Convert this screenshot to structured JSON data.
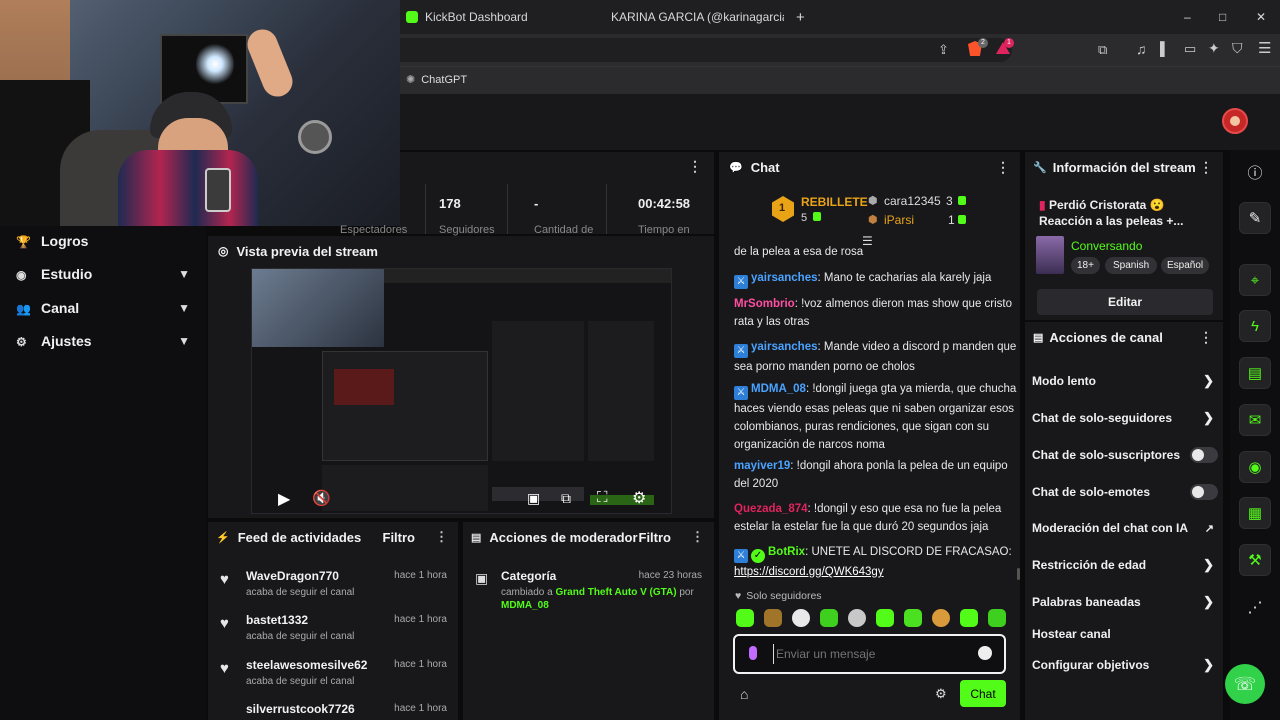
{
  "browser": {
    "tabs": [
      {
        "title": "KickBot Dashboard",
        "color": "#53fc18"
      },
      {
        "title": "KARINA GARCIA (@karinagarciaofici",
        "color": "#d62976"
      }
    ],
    "new_tab": "+",
    "window": {
      "minimize": "–",
      "maximize": "□",
      "close": "✕"
    },
    "bookmark": "ChatGPT",
    "toolbar_badges": {
      "brave": "2",
      "alert": "1"
    }
  },
  "stats": [
    {
      "value": "178",
      "label": "Seguidores"
    },
    {
      "value": "-",
      "label": "Cantidad de"
    },
    {
      "value": "00:42:58",
      "label": "Tiempo en"
    }
  ],
  "stats_first_label": "Espectadores",
  "leftnav": {
    "items": [
      {
        "label": "Logros",
        "icon": "trophy-icon",
        "glyph": "🏆",
        "chevron": false
      },
      {
        "label": "Estudio",
        "icon": "camera-icon",
        "glyph": "◉",
        "chevron": true
      },
      {
        "label": "Canal",
        "icon": "users-icon",
        "glyph": "👥",
        "chevron": true
      },
      {
        "label": "Ajustes",
        "icon": "gear-icon",
        "glyph": "⚙",
        "chevron": true
      }
    ]
  },
  "preview": {
    "title": "Vista previa del stream"
  },
  "feed": {
    "title": "Feed de actividades",
    "filter": "Filtro",
    "items": [
      {
        "name": "WaveDragon770",
        "time": "hace 1 hora",
        "desc": "acaba de seguir el canal"
      },
      {
        "name": "bastet1332",
        "time": "hace 1 hora",
        "desc": "acaba de seguir el canal"
      },
      {
        "name": "steelawesomesilve62",
        "time": "hace 1 hora",
        "desc": "acaba de seguir el canal"
      },
      {
        "name": "silverrustcook7726",
        "time": "hace 1 hora",
        "desc": ""
      }
    ]
  },
  "mod_actions": {
    "title": "Acciones de moderador",
    "filter": "Filtro",
    "items": [
      {
        "label": "Categoría",
        "time": "hace 23 horas",
        "pre": "cambiado a ",
        "highlight": "Grand Theft Auto V (GTA)",
        "mid": " por ",
        "user": "MDMA_08"
      }
    ]
  },
  "chat": {
    "title": "Chat",
    "leaderboard": {
      "top": {
        "rank": "1",
        "name": "REBILLETE",
        "score": "5"
      },
      "second": {
        "name": "cara12345",
        "score": "3"
      },
      "third": {
        "name": "iParsi",
        "score": "1"
      }
    },
    "partial_top": "de la pelea a esa de rosa",
    "messages": [
      {
        "user": "yairsanches",
        "color": "#4aa3ff",
        "badge": true,
        "text": ": Mano te cacharias ala karely jaja"
      },
      {
        "user": "MrSombrio",
        "color": "#ff4fa0",
        "badge": false,
        "text": ": !voz almenos dieron mas show que cristo rata y las otras"
      },
      {
        "user": "yairsanches",
        "color": "#4aa3ff",
        "badge": true,
        "text": ": Mande video a discord p manden que sea porno manden porno oe cholos"
      },
      {
        "user": "MDMA_08",
        "color": "#4aa3ff",
        "badge": true,
        "text": ": !dongil juega gta ya mierda, que chucha haces viendo esas peleas que ni saben organizar esos colombianos, puras rendiciones, que sigan con su organización de narcos noma"
      },
      {
        "user": "mayiver19",
        "color": "#4aa3ff",
        "badge": false,
        "text": ": !dongil ahora ponla la pelea de un equipo del 2020"
      },
      {
        "user": "Quezada_874",
        "color": "#e0245e",
        "badge": false,
        "text": ": !dongil y eso que esa no fue la pelea estelar la estelar fue la que duró 20 segundos jaja"
      },
      {
        "user": "BotRix",
        "color": "#53fc18",
        "badge": true,
        "text": ": UNETE AL DISCORD DE FRACASAO: ",
        "link": "https://discord.gg/QWK643gy"
      }
    ],
    "mode": "Solo seguidores",
    "input_placeholder": "Enviar un mensaje",
    "send_label": "Chat"
  },
  "stream_info": {
    "title": "Información del stream",
    "stream_title": "Perdió Cristorata 😮 Reacción a las peleas +...",
    "category": "Conversando",
    "tags": [
      "18+",
      "Spanish",
      "Español"
    ],
    "edit": "Editar"
  },
  "channel_actions": {
    "title": "Acciones de canal",
    "items": [
      {
        "label": "Modo lento",
        "control": "chevron"
      },
      {
        "label": "Chat de solo-seguidores",
        "control": "chevron"
      },
      {
        "label": "Chat de solo-suscriptores",
        "control": "toggle"
      },
      {
        "label": "Chat de solo-emotes",
        "control": "toggle"
      },
      {
        "label": "Moderación del chat con IA",
        "control": "external"
      },
      {
        "label": "Restricción de edad",
        "control": "chevron"
      },
      {
        "label": "Palabras baneadas",
        "control": "chevron"
      },
      {
        "label": "Hostear canal",
        "control": "none"
      },
      {
        "label": "Configurar objetivos",
        "control": "chevron"
      }
    ]
  },
  "colors": {
    "accent": "#53fc18",
    "panel": "#18181b",
    "bg": "#0b0b0c"
  }
}
